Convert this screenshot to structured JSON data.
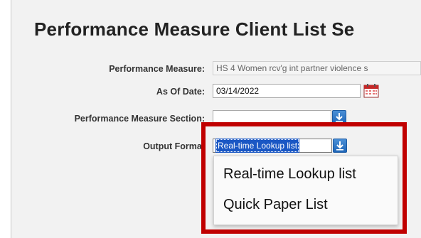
{
  "page": {
    "title": "Performance Measure Client List Se"
  },
  "form": {
    "performance_measure": {
      "label": "Performance Measure:",
      "value": "HS 4 Women rcv'g int partner violence s"
    },
    "as_of_date": {
      "label": "As Of Date:",
      "value": "03/14/2022"
    },
    "section": {
      "label": "Performance Measure Section:",
      "value": ""
    },
    "output_format": {
      "label": "Output Format",
      "selected": "Real-time Lookup list",
      "options": [
        "Real-time Lookup list",
        "Quick Paper List"
      ]
    }
  },
  "colors": {
    "highlight_box": "#c00000",
    "dropdown_button": "#1f66b8",
    "selection": "#1a57c4"
  },
  "icons": [
    "dropdown-arrow-icon",
    "calendar-icon"
  ]
}
